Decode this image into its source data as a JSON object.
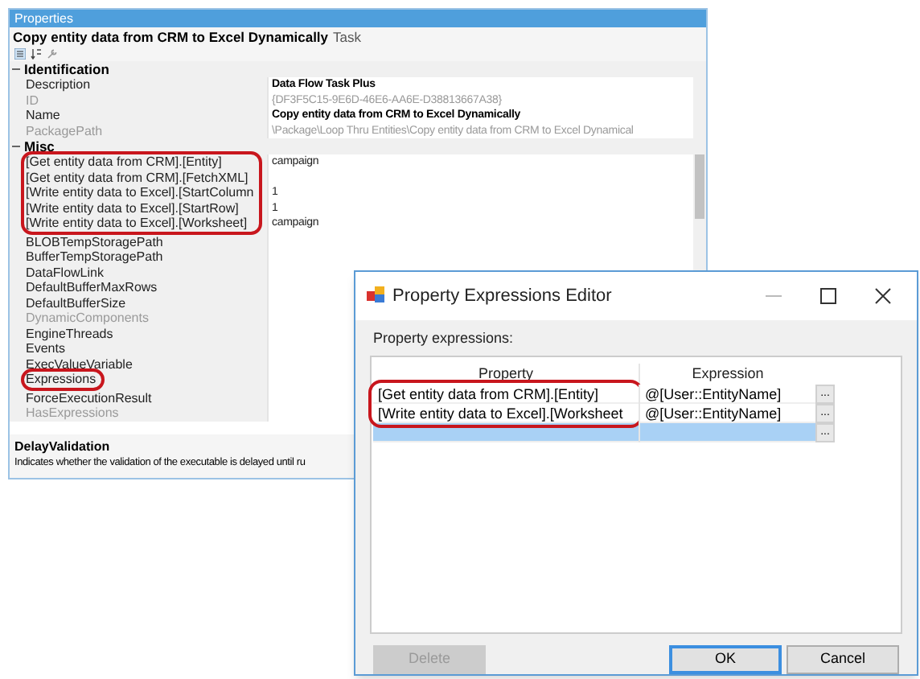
{
  "properties_panel": {
    "title": "Properties",
    "object_name": "Copy entity data from CRM to Excel Dynamically",
    "object_type": "Task",
    "sections": [
      {
        "name": "Identification",
        "expanded": true,
        "rows": [
          {
            "name": "Description",
            "value": "Data Flow Task Plus",
            "modified": true,
            "disabled": false,
            "highlighted": false
          },
          {
            "name": "ID",
            "value": "{DF3F5C15-9E6D-46E6-AA6E-D38813667A38}",
            "modified": false,
            "disabled": true,
            "highlighted": false
          },
          {
            "name": "Name",
            "value": "Copy entity data from CRM to Excel Dynamically",
            "modified": true,
            "disabled": false,
            "highlighted": false
          },
          {
            "name": "PackagePath",
            "value": "\\Package\\Loop Thru Entities\\Copy entity data from CRM to Excel Dynamical",
            "modified": false,
            "disabled": true,
            "highlighted": false
          }
        ]
      },
      {
        "name": "Misc",
        "expanded": true,
        "rows": [
          {
            "name": "[Get entity data from CRM].[Entity]",
            "value": "campaign",
            "modified": false,
            "disabled": false,
            "highlighted": true
          },
          {
            "name": "[Get entity data from CRM].[FetchXML]",
            "disabled": false,
            "highlighted": true
          },
          {
            "name": "[Write entity data to Excel].[StartColumn",
            "value": "1",
            "modified": false,
            "disabled": false,
            "highlighted": true
          },
          {
            "name": "[Write entity data to Excel].[StartRow]",
            "value": "1",
            "modified": false,
            "disabled": false,
            "highlighted": true
          },
          {
            "name": "[Write entity data to Excel].[Worksheet]",
            "value": "campaign",
            "modified": false,
            "disabled": false,
            "highlighted": true
          },
          {
            "name": "BLOBTempStoragePath",
            "disabled": false,
            "highlighted": false
          },
          {
            "name": "BufferTempStoragePath",
            "disabled": false,
            "highlighted": false
          },
          {
            "name": "DataFlowLink",
            "disabled": false,
            "highlighted": false
          },
          {
            "name": "DefaultBufferMaxRows",
            "disabled": false,
            "highlighted": false
          },
          {
            "name": "DefaultBufferSize",
            "disabled": false,
            "highlighted": false
          },
          {
            "name": "DynamicComponents",
            "disabled": true,
            "highlighted": false
          },
          {
            "name": "EngineThreads",
            "disabled": false,
            "highlighted": false
          },
          {
            "name": "Events",
            "disabled": false,
            "highlighted": false
          },
          {
            "name": "ExecValueVariable",
            "disabled": false,
            "highlighted": false
          },
          {
            "name": "Expressions",
            "disabled": false,
            "highlighted": true
          },
          {
            "name": "ForceExecutionResult",
            "disabled": false,
            "highlighted": false
          },
          {
            "name": "HasExpressions",
            "disabled": true,
            "highlighted": false
          }
        ]
      }
    ],
    "description": {
      "title": "DelayValidation",
      "text": "Indicates whether the validation of the executable is delayed until ru"
    }
  },
  "dialog": {
    "title": "Property Expressions Editor",
    "label": "Property expressions:",
    "columns": [
      "Property",
      "Expression"
    ],
    "rows": [
      {
        "property": "[Get entity data from CRM].[Entity]",
        "expression": "@[User::EntityName]",
        "button": "...",
        "highlighted": true,
        "selected": false
      },
      {
        "property": "[Write entity data to Excel].[Worksheet",
        "expression": "@[User::EntityName]",
        "button": "...",
        "highlighted": true,
        "selected": false
      },
      {
        "button": "...",
        "highlighted": false,
        "selected": true
      }
    ],
    "buttons": [
      {
        "label": "Delete",
        "disabled": true,
        "default": false
      },
      {
        "label": "OK",
        "disabled": false,
        "default": true
      },
      {
        "label": "Cancel",
        "disabled": false,
        "default": false
      }
    ]
  }
}
